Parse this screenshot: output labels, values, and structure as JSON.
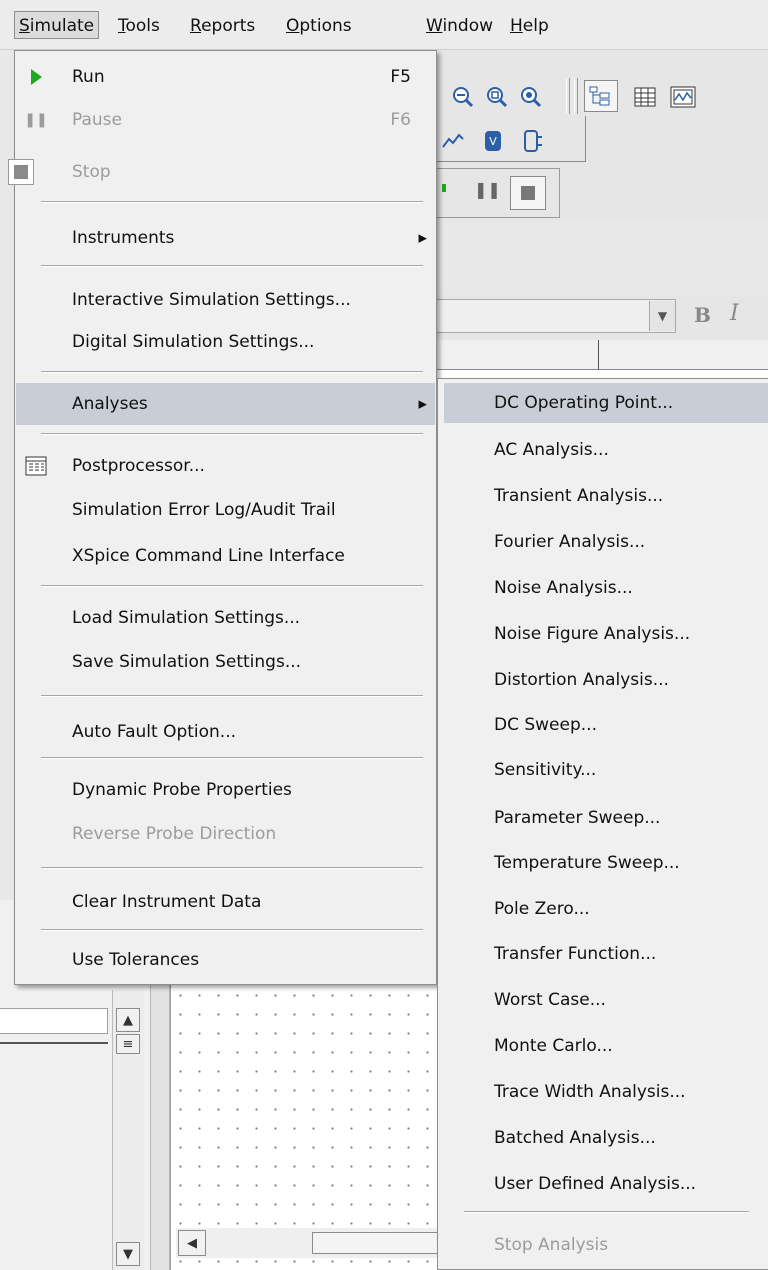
{
  "menubar": {
    "items": [
      {
        "label": "Simulate",
        "access": "S"
      },
      {
        "label": "Tools",
        "access": "T"
      },
      {
        "label": "Reports",
        "access": "R"
      },
      {
        "label": "Options",
        "access": "O"
      },
      {
        "label": "Window",
        "access": "W"
      },
      {
        "label": "Help",
        "access": "H"
      }
    ]
  },
  "simulate_menu": {
    "run": {
      "label": "Run",
      "shortcut": "F5"
    },
    "pause": {
      "label": "Pause",
      "shortcut": "F6"
    },
    "stop": {
      "label": "Stop"
    },
    "instruments": {
      "label": "Instruments"
    },
    "interactive": {
      "label": "Interactive Simulation Settings..."
    },
    "digital": {
      "label": "Digital Simulation Settings..."
    },
    "analyses": {
      "label": "Analyses"
    },
    "postprocessor": {
      "label": "Postprocessor..."
    },
    "error_log": {
      "label": "Simulation Error Log/Audit Trail"
    },
    "xspice": {
      "label": "XSpice Command Line Interface"
    },
    "load_settings": {
      "label": "Load Simulation Settings..."
    },
    "save_settings": {
      "label": "Save Simulation Settings..."
    },
    "auto_fault": {
      "label": "Auto Fault Option..."
    },
    "dynamic_probe": {
      "label": "Dynamic Probe Properties"
    },
    "reverse_probe": {
      "label": "Reverse Probe Direction"
    },
    "clear_data": {
      "label": "Clear Instrument Data"
    },
    "tolerances": {
      "label": "Use Tolerances"
    }
  },
  "analyses_menu": {
    "items": [
      "DC Operating Point...",
      "AC Analysis...",
      "Transient Analysis...",
      "Fourier Analysis...",
      "Noise Analysis...",
      "Noise Figure Analysis...",
      "Distortion Analysis...",
      "DC Sweep...",
      "Sensitivity...",
      "Parameter Sweep...",
      "Temperature Sweep...",
      "Pole Zero...",
      "Transfer Function...",
      "Worst Case...",
      "Monte Carlo...",
      "Trace Width Analysis...",
      "Batched Analysis...",
      "User Defined Analysis..."
    ],
    "stop": "Stop Analysis"
  },
  "format_toolbar": {
    "bold": "B",
    "italic": "I"
  },
  "colors": {
    "highlight": "#c9ced6",
    "menu_bg": "#f0f0f0",
    "disabled": "#9c9c9c",
    "run_green": "#1fa81f"
  }
}
